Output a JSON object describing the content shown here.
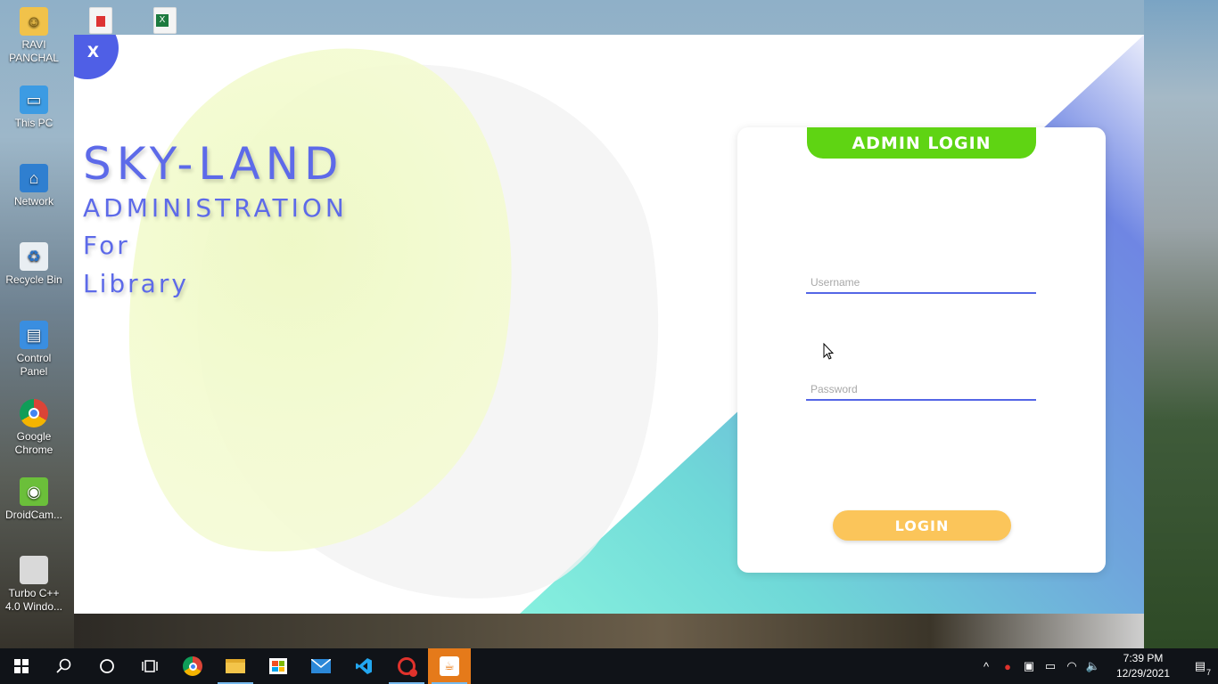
{
  "desktop": {
    "icons": [
      {
        "label": "RAVI PANCHAL",
        "icon": "user-folder-icon"
      },
      {
        "label": "This PC",
        "icon": "computer-icon"
      },
      {
        "label": "Network",
        "icon": "network-icon"
      },
      {
        "label": "Recycle Bin",
        "icon": "recycle-bin-icon"
      },
      {
        "label": "Control Panel",
        "icon": "control-panel-icon"
      },
      {
        "label": "Google Chrome",
        "icon": "chrome-icon"
      },
      {
        "label": "DroidCam...",
        "icon": "droidcam-icon"
      },
      {
        "label": "Turbo C++ 4.0 Windo...",
        "icon": "turbo-cpp-icon"
      }
    ]
  },
  "window": {
    "close_label": "X",
    "brand": {
      "title": "SKY-LAND",
      "subtitle": "ADMINISTRATION",
      "line1": "For",
      "line2": "Library"
    },
    "login": {
      "header": "ADMIN LOGIN",
      "username_placeholder": "Username",
      "password_placeholder": "Password",
      "button_label": "LOGIN"
    }
  },
  "taskbar": {
    "apps": [
      "start-icon",
      "search-icon",
      "cortana-icon",
      "task-view-icon",
      "chrome-icon",
      "file-explorer-icon",
      "store-icon",
      "mail-icon",
      "vscode-icon",
      "recorder-icon",
      "java-icon"
    ],
    "clock_time": "7:39 PM",
    "clock_date": "12/29/2021",
    "notification_count": "7"
  },
  "colors": {
    "accent_blue": "#5466e6",
    "header_green": "#5fd413",
    "login_orange": "#fbc55a",
    "brand_text": "#5d6ae9"
  }
}
